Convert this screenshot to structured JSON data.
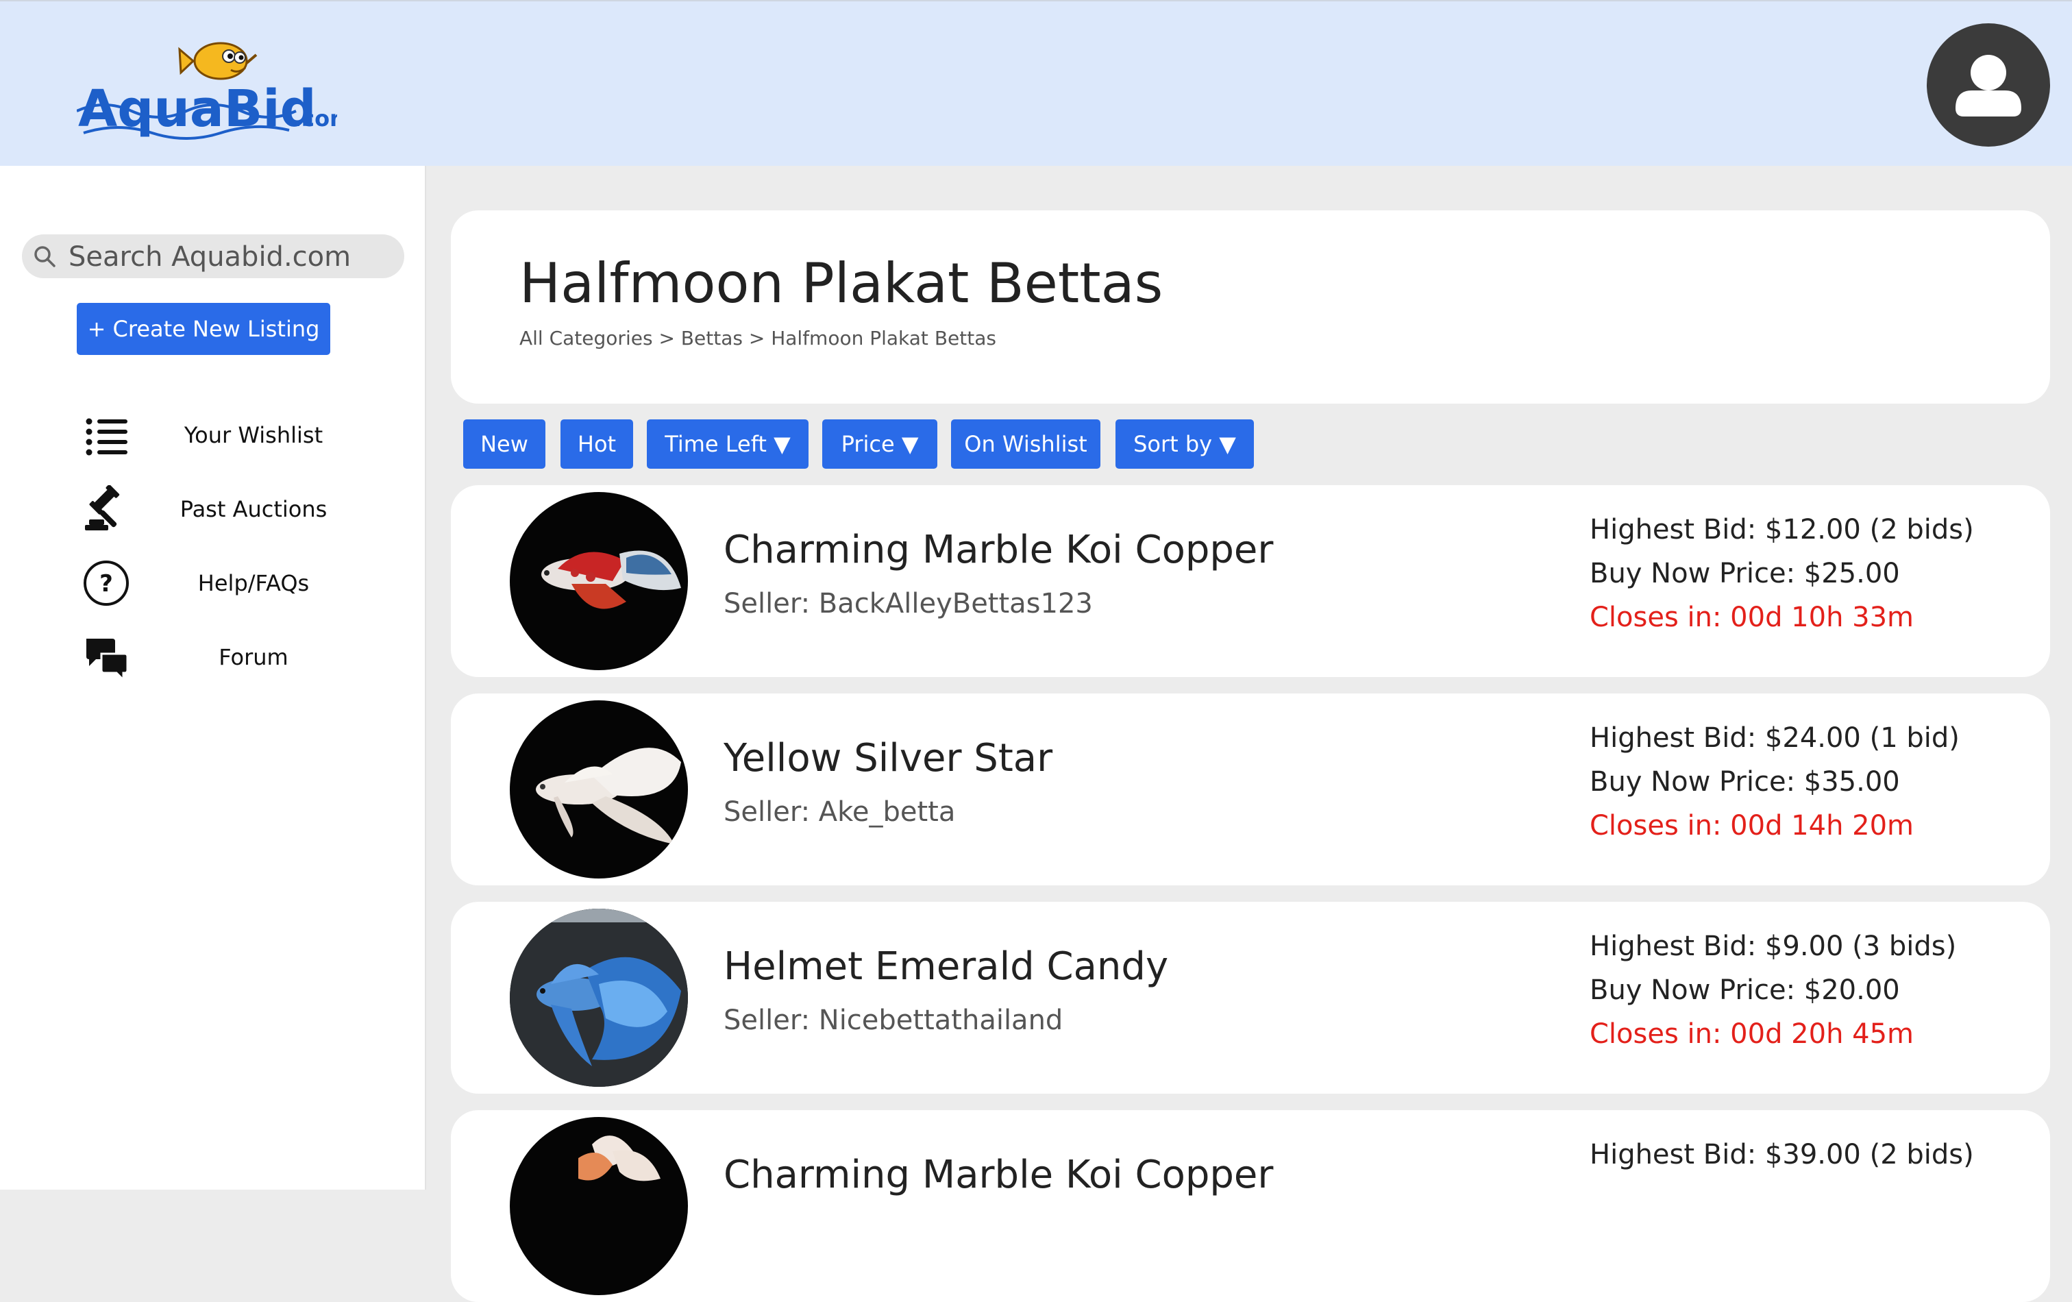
{
  "header": {
    "logo_main": "AquaBid",
    "logo_suffix": ".com"
  },
  "sidebar": {
    "search_placeholder": "Search Aquabid.com",
    "create_label": "+ Create New Listing",
    "nav": [
      {
        "label": "Your Wishlist",
        "icon": "list-icon"
      },
      {
        "label": "Past Auctions",
        "icon": "gavel-icon"
      },
      {
        "label": "Help/FAQs",
        "icon": "help-icon"
      },
      {
        "label": "Forum",
        "icon": "chat-icon"
      }
    ]
  },
  "page": {
    "title": "Halfmoon Plakat Bettas",
    "breadcrumb": "All Categories > Bettas > Halfmoon Plakat Bettas"
  },
  "filters": [
    {
      "label": "New"
    },
    {
      "label": "Hot"
    },
    {
      "label": "Time Left ▼"
    },
    {
      "label": "Price ▼"
    },
    {
      "label": "On Wishlist"
    },
    {
      "label": "Sort by ▼"
    }
  ],
  "listings": [
    {
      "name": "Charming Marble Koi Copper",
      "seller": "Seller: BackAlleyBettas123",
      "bid": "Highest Bid: $12.00 (2 bids)",
      "buy": "Buy Now Price: $25.00",
      "closes": "Closes in: 00d 10h 33m"
    },
    {
      "name": "Yellow Silver Star",
      "seller": "Seller: Ake_betta",
      "bid": "Highest Bid: $24.00 (1 bid)",
      "buy": "Buy Now Price: $35.00",
      "closes": "Closes in: 00d 14h 20m"
    },
    {
      "name": "Helmet Emerald Candy",
      "seller": "Seller: Nicebettathailand",
      "bid": "Highest Bid: $9.00 (3 bids)",
      "buy": "Buy Now Price: $20.00",
      "closes": "Closes in: 00d 20h 45m"
    },
    {
      "name": "Charming Marble Koi Copper",
      "seller": "",
      "bid": "Highest Bid: $39.00 (2 bids)",
      "buy": "",
      "closes": ""
    }
  ],
  "colors": {
    "accent": "#2a6be8",
    "header_bg": "#dce8fb",
    "closing_red": "#e3201a"
  }
}
